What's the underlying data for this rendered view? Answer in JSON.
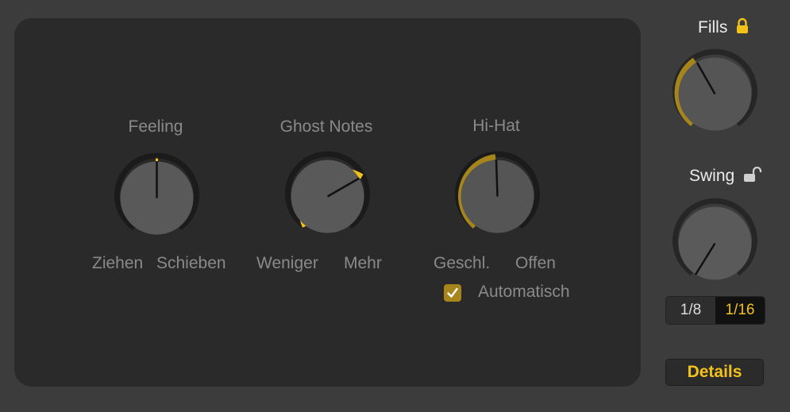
{
  "colors": {
    "accent": "#f2c21b",
    "accent_dim": "#a6861a",
    "panel": "#2a2a2a",
    "background": "#3c3c3c"
  },
  "knobs": {
    "feeling": {
      "title": "Feeling",
      "left_label": "Ziehen",
      "right_label": "Schieben"
    },
    "ghost_notes": {
      "title": "Ghost Notes",
      "left_label": "Weniger",
      "right_label": "Mehr"
    },
    "hihat": {
      "title": "Hi-Hat",
      "left_label": "Geschl.",
      "right_label": "Offen"
    }
  },
  "automatic": {
    "label": "Automatisch",
    "checked": true
  },
  "fills": {
    "title": "Fills",
    "locked": true,
    "icon": "lock-closed-icon"
  },
  "swing": {
    "title": "Swing",
    "locked": false,
    "icon": "lock-open-icon"
  },
  "resolution": {
    "options": [
      "1/8",
      "1/16"
    ],
    "selected": "1/16"
  },
  "details_button": {
    "label": "Details"
  }
}
